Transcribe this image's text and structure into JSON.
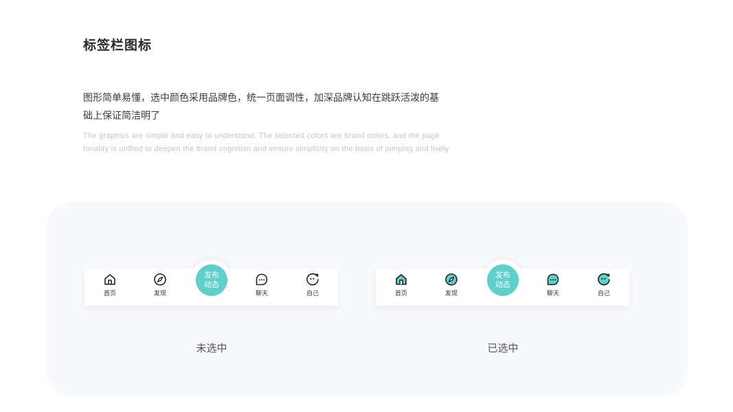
{
  "title": "标签栏图标",
  "description_cn_line1": "图形简单易懂，选中颜色采用品牌色，统一页面调性，加深品牌认知在跳跃活泼的基",
  "description_cn_line2": "础上保证简洁明了",
  "description_en_line1": "The graphics are simple and easy to understand. The selected colors are brand colors, and the page",
  "description_en_line2": "tonality is unified to deepen the brand cognition and ensure simplicity on the basis of jumping and lively",
  "brand_color": "#5fcfcb",
  "icon_stroke_color": "#222222",
  "tabbars": [
    {
      "state_label": "未选中",
      "tabs": [
        {
          "label": "首页",
          "icon": "home-icon"
        },
        {
          "label": "发现",
          "icon": "compass-icon"
        },
        {
          "label_line1": "发布",
          "label_line2": "动态",
          "icon": "publish-button"
        },
        {
          "label": "聊天",
          "icon": "chat-bubble-icon"
        },
        {
          "label": "自己",
          "icon": "face-icon"
        }
      ]
    },
    {
      "state_label": "已选中",
      "tabs": [
        {
          "label": "首页",
          "icon": "home-icon"
        },
        {
          "label": "发现",
          "icon": "compass-icon"
        },
        {
          "label_line1": "发布",
          "label_line2": "动态",
          "icon": "publish-button"
        },
        {
          "label": "聊天",
          "icon": "chat-bubble-icon"
        },
        {
          "label": "自己",
          "icon": "face-icon"
        }
      ]
    }
  ]
}
